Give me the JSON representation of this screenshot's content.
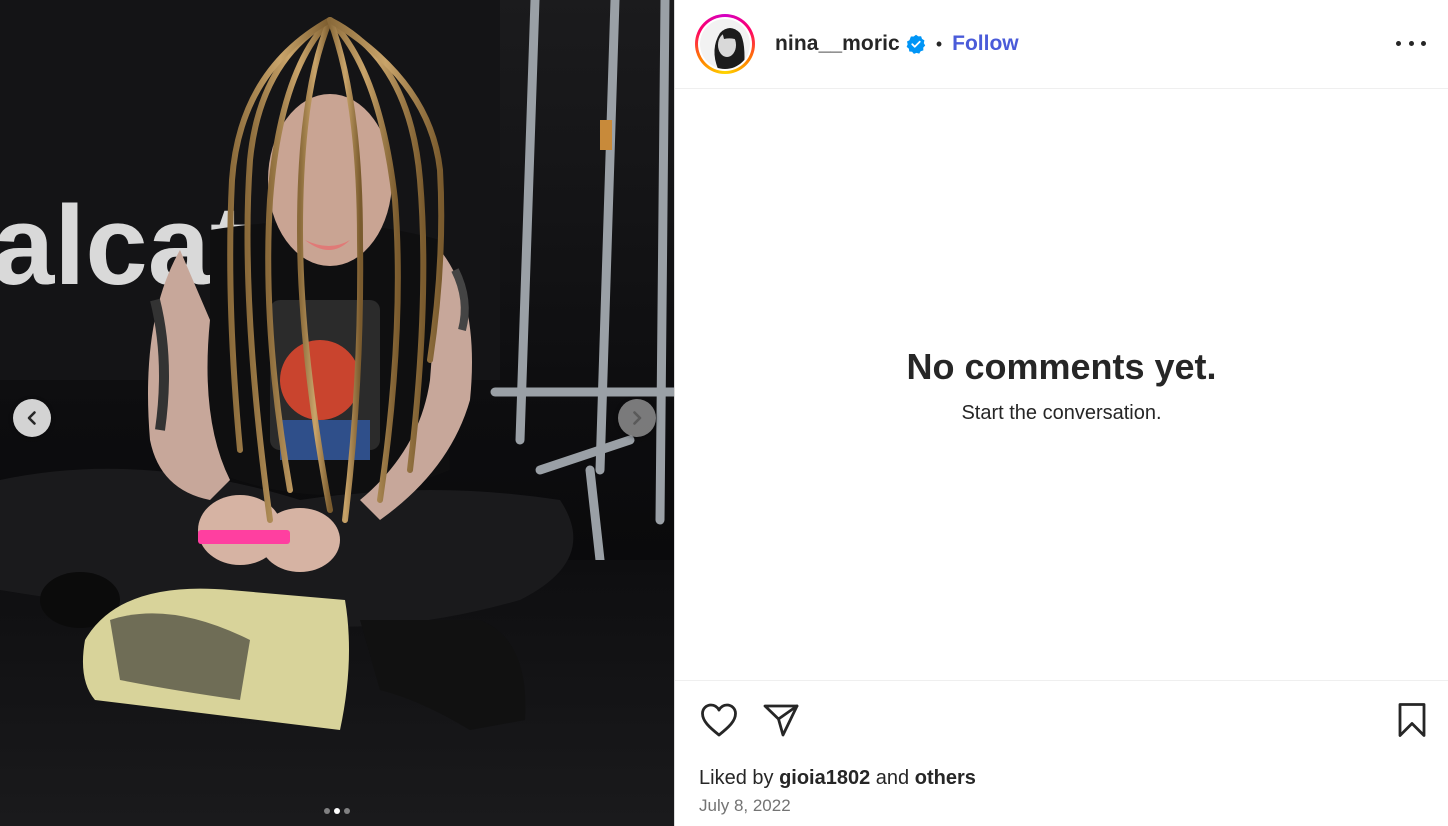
{
  "post": {
    "carousel": {
      "slide_count": 3,
      "active_slide": 2,
      "backdrop_text": "alcat"
    },
    "header": {
      "username": "nina__moric",
      "verified": true,
      "separator": "•",
      "follow_label": "Follow"
    },
    "comments": {
      "empty_title": "No comments yet.",
      "empty_subtitle": "Start the conversation."
    },
    "footer": {
      "liked_prefix": "Liked by",
      "liked_user": "gioia1802",
      "liked_and": "and",
      "liked_others": "others",
      "date": "July 8, 2022"
    },
    "colors": {
      "follow": "#4a5bd9",
      "verified": "#0095f6",
      "text": "#262626",
      "muted": "#737373"
    },
    "icons": [
      "chevron-left-icon",
      "chevron-right-icon",
      "verified-badge-icon",
      "more-icon",
      "heart-icon",
      "share-icon",
      "bookmark-icon"
    ]
  }
}
